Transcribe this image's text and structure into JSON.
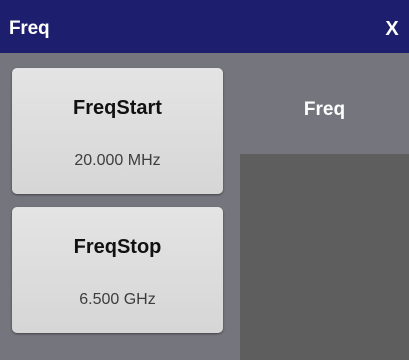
{
  "window": {
    "title": "Freq",
    "close_label": "X"
  },
  "softkeys": [
    {
      "label": "FreqStart",
      "value": "20.000 MHz"
    },
    {
      "label": "FreqStop",
      "value": "6.500 GHz"
    }
  ],
  "panel": {
    "title": "Freq"
  },
  "colors": {
    "titlebar": "#1d1f6e",
    "background": "#75757d",
    "button": "#dcdcdc",
    "display": "#5e5e5e"
  }
}
